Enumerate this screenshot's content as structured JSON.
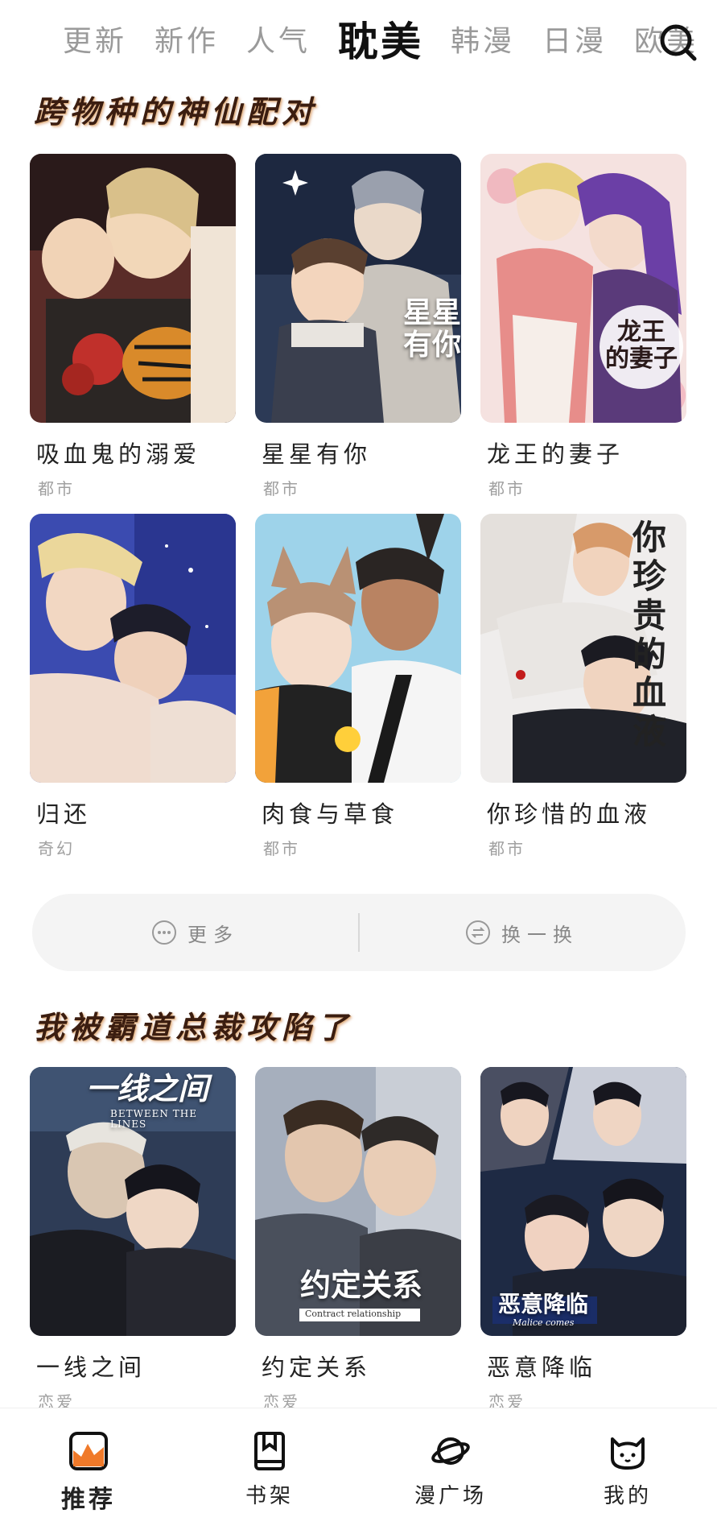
{
  "tabs": [
    {
      "label": "更新",
      "active": false
    },
    {
      "label": "新作",
      "active": false
    },
    {
      "label": "人气",
      "active": false
    },
    {
      "label": "耽美",
      "active": true
    },
    {
      "label": "韩漫",
      "active": false
    },
    {
      "label": "日漫",
      "active": false
    },
    {
      "label": "欧美",
      "active": false
    }
  ],
  "sections": [
    {
      "title": "跨物种的神仙配对",
      "cards": [
        {
          "title": "吸血鬼的溺爱",
          "genre": "都市",
          "cover_text": ""
        },
        {
          "title": "星星有你",
          "genre": "都市",
          "cover_text": "星星\n有你"
        },
        {
          "title": "龙王的妻子",
          "genre": "都市",
          "cover_text": "龙王\n的妻子"
        },
        {
          "title": "归还",
          "genre": "奇幻",
          "cover_text": ""
        },
        {
          "title": "肉食与草食",
          "genre": "都市",
          "cover_text": ""
        },
        {
          "title": "你珍惜的血液",
          "genre": "都市",
          "cover_text": "你珍贵的血液"
        }
      ]
    },
    {
      "title": "我被霸道总裁攻陷了",
      "cards": [
        {
          "title": "一线之间",
          "genre": "恋爱",
          "cover_text": "一线之间",
          "cover_sub": "BETWEEN THE LINES"
        },
        {
          "title": "约定关系",
          "genre": "恋爱",
          "cover_text": "约定关系",
          "cover_sub": "Contract relationship"
        },
        {
          "title": "恶意降临",
          "genre": "恋爱",
          "cover_text": "恶意降临",
          "cover_sub": "Malice comes"
        }
      ]
    }
  ],
  "actions": {
    "more": "更多",
    "refresh": "换一换"
  },
  "bottom_nav": [
    {
      "label": "推荐",
      "icon": "recommend-icon",
      "active": true
    },
    {
      "label": "书架",
      "icon": "bookshelf-icon",
      "active": false
    },
    {
      "label": "漫广场",
      "icon": "planet-icon",
      "active": false
    },
    {
      "label": "我的",
      "icon": "cat-face-icon",
      "active": false
    }
  ],
  "colors": {
    "accent": "#f07a2a",
    "title_brown": "#3b1d10",
    "muted": "#a0a0a0"
  }
}
